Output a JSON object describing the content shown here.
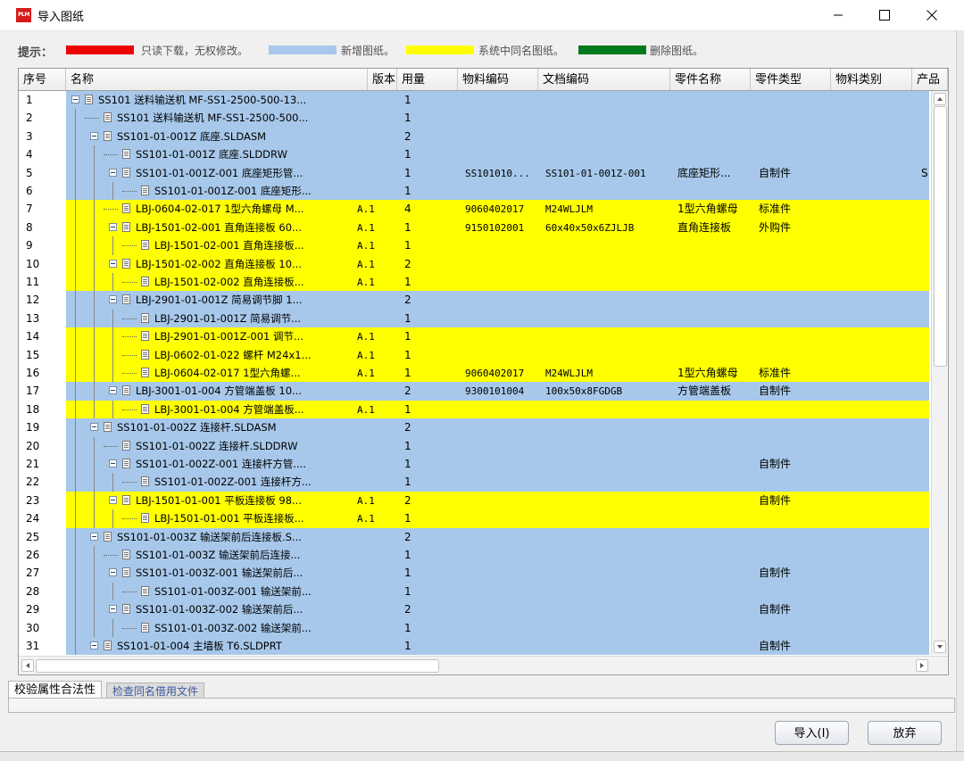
{
  "window": {
    "title": "导入图纸",
    "app_icon_text": "PLM"
  },
  "hint": {
    "label": "提示：",
    "legend": [
      {
        "color": "#ee0000",
        "text": "只读下载，无权修改。"
      },
      {
        "color": "#a7c8ea",
        "text": "新增图纸。"
      },
      {
        "color": "#ffff00",
        "text": "系统中同名图纸。"
      },
      {
        "color": "#007a1c",
        "text": "删除图纸。"
      }
    ]
  },
  "colors": {
    "blue": "#a7c8ea",
    "yellow": "#ffff00"
  },
  "columns": [
    "序号",
    "名称",
    "版本",
    "用量",
    "物料编码",
    "文档编码",
    "零件名称",
    "零件类型",
    "物料类别",
    "产品"
  ],
  "rows": [
    {
      "seq": "1",
      "level": 0,
      "exp": true,
      "name": "SS101 送料输送机 MF-SS1-2500-500-13...",
      "ver": "",
      "qty": "1",
      "mat": "",
      "doc": "",
      "part": "",
      "type": "",
      "cat": "",
      "prod": "",
      "color": "blue"
    },
    {
      "seq": "2",
      "level": 1,
      "exp": false,
      "name": "SS101 送料输送机 MF-SS1-2500-500...",
      "ver": "",
      "qty": "1",
      "mat": "",
      "doc": "",
      "part": "",
      "type": "",
      "cat": "",
      "prod": "",
      "color": "blue"
    },
    {
      "seq": "3",
      "level": 1,
      "exp": true,
      "name": "SS101-01-001Z 底座.SLDASM",
      "ver": "",
      "qty": "2",
      "mat": "",
      "doc": "",
      "part": "",
      "type": "",
      "cat": "",
      "prod": "",
      "color": "blue"
    },
    {
      "seq": "4",
      "level": 2,
      "exp": false,
      "name": "SS101-01-001Z 底座.SLDDRW",
      "ver": "",
      "qty": "1",
      "mat": "",
      "doc": "",
      "part": "",
      "type": "",
      "cat": "",
      "prod": "",
      "color": "blue"
    },
    {
      "seq": "5",
      "level": 2,
      "exp": true,
      "name": "SS101-01-001Z-001 底座矩形管...",
      "ver": "",
      "qty": "1",
      "mat": "SS101010...",
      "doc": "SS101-01-001Z-001",
      "part": "底座矩形...",
      "type": "自制件",
      "cat": "",
      "prod": "S:",
      "color": "blue"
    },
    {
      "seq": "6",
      "level": 3,
      "exp": false,
      "name": "SS101-01-001Z-001 底座矩形...",
      "ver": "",
      "qty": "1",
      "mat": "",
      "doc": "",
      "part": "",
      "type": "",
      "cat": "",
      "prod": "",
      "color": "blue"
    },
    {
      "seq": "7",
      "level": 2,
      "exp": false,
      "name": "LBJ-0604-02-017 1型六角螺母 M...",
      "ver": "A.1",
      "qty": "4",
      "mat": "9060402017",
      "doc": "M24WLJLM",
      "part": "1型六角螺母",
      "type": "标准件",
      "cat": "",
      "prod": "",
      "color": "yellow"
    },
    {
      "seq": "8",
      "level": 2,
      "exp": true,
      "name": "LBJ-1501-02-001 直角连接板 60...",
      "ver": "A.1",
      "qty": "1",
      "mat": "9150102001",
      "doc": "60x40x50x6ZJLJB",
      "part": "直角连接板",
      "type": "外购件",
      "cat": "",
      "prod": "",
      "color": "yellow"
    },
    {
      "seq": "9",
      "level": 3,
      "exp": false,
      "name": "LBJ-1501-02-001 直角连接板...",
      "ver": "A.1",
      "qty": "1",
      "mat": "",
      "doc": "",
      "part": "",
      "type": "",
      "cat": "",
      "prod": "",
      "color": "yellow"
    },
    {
      "seq": "10",
      "level": 2,
      "exp": true,
      "name": "LBJ-1501-02-002 直角连接板 10...",
      "ver": "A.1",
      "qty": "2",
      "mat": "",
      "doc": "",
      "part": "",
      "type": "",
      "cat": "",
      "prod": "",
      "color": "yellow"
    },
    {
      "seq": "11",
      "level": 3,
      "exp": false,
      "name": "LBJ-1501-02-002 直角连接板...",
      "ver": "A.1",
      "qty": "1",
      "mat": "",
      "doc": "",
      "part": "",
      "type": "",
      "cat": "",
      "prod": "",
      "color": "yellow"
    },
    {
      "seq": "12",
      "level": 2,
      "exp": true,
      "name": "LBJ-2901-01-001Z 简易调节脚 1...",
      "ver": "",
      "qty": "2",
      "mat": "",
      "doc": "",
      "part": "",
      "type": "",
      "cat": "",
      "prod": "",
      "color": "blue"
    },
    {
      "seq": "13",
      "level": 3,
      "exp": false,
      "name": "LBJ-2901-01-001Z 简易调节...",
      "ver": "",
      "qty": "1",
      "mat": "",
      "doc": "",
      "part": "",
      "type": "",
      "cat": "",
      "prod": "",
      "color": "blue"
    },
    {
      "seq": "14",
      "level": 3,
      "exp": false,
      "name": "LBJ-2901-01-001Z-001 调节...",
      "ver": "A.1",
      "qty": "1",
      "mat": "",
      "doc": "",
      "part": "",
      "type": "",
      "cat": "",
      "prod": "",
      "color": "yellow"
    },
    {
      "seq": "15",
      "level": 3,
      "exp": false,
      "name": "LBJ-0602-01-022 螺杆 M24x1...",
      "ver": "A.1",
      "qty": "1",
      "mat": "",
      "doc": "",
      "part": "",
      "type": "",
      "cat": "",
      "prod": "",
      "color": "yellow"
    },
    {
      "seq": "16",
      "level": 3,
      "exp": false,
      "name": "LBJ-0604-02-017 1型六角螺...",
      "ver": "A.1",
      "qty": "1",
      "mat": "9060402017",
      "doc": "M24WLJLM",
      "part": "1型六角螺母",
      "type": "标准件",
      "cat": "",
      "prod": "",
      "color": "yellow"
    },
    {
      "seq": "17",
      "level": 2,
      "exp": true,
      "name": "LBJ-3001-01-004 方管端盖板 10...",
      "ver": "",
      "qty": "2",
      "mat": "9300101004",
      "doc": "100x50x8FGDGB",
      "part": "方管端盖板",
      "type": "自制件",
      "cat": "",
      "prod": "",
      "color": "blue"
    },
    {
      "seq": "18",
      "level": 3,
      "exp": false,
      "name": "LBJ-3001-01-004 方管端盖板...",
      "ver": "A.1",
      "qty": "1",
      "mat": "",
      "doc": "",
      "part": "",
      "type": "",
      "cat": "",
      "prod": "",
      "color": "yellow"
    },
    {
      "seq": "19",
      "level": 1,
      "exp": true,
      "name": "SS101-01-002Z 连接杆.SLDASM",
      "ver": "",
      "qty": "2",
      "mat": "",
      "doc": "",
      "part": "",
      "type": "",
      "cat": "",
      "prod": "",
      "color": "blue"
    },
    {
      "seq": "20",
      "level": 2,
      "exp": false,
      "name": "SS101-01-002Z 连接杆.SLDDRW",
      "ver": "",
      "qty": "1",
      "mat": "",
      "doc": "",
      "part": "",
      "type": "",
      "cat": "",
      "prod": "",
      "color": "blue"
    },
    {
      "seq": "21",
      "level": 2,
      "exp": true,
      "name": "SS101-01-002Z-001 连接杆方管....",
      "ver": "",
      "qty": "1",
      "mat": "",
      "doc": "",
      "part": "",
      "type": "自制件",
      "cat": "",
      "prod": "",
      "color": "blue"
    },
    {
      "seq": "22",
      "level": 3,
      "exp": false,
      "name": "SS101-01-002Z-001 连接杆方...",
      "ver": "",
      "qty": "1",
      "mat": "",
      "doc": "",
      "part": "",
      "type": "",
      "cat": "",
      "prod": "",
      "color": "blue"
    },
    {
      "seq": "23",
      "level": 2,
      "exp": true,
      "name": "LBJ-1501-01-001 平板连接板 98...",
      "ver": "A.1",
      "qty": "2",
      "mat": "",
      "doc": "",
      "part": "",
      "type": "自制件",
      "cat": "",
      "prod": "",
      "color": "yellow"
    },
    {
      "seq": "24",
      "level": 3,
      "exp": false,
      "name": "LBJ-1501-01-001 平板连接板...",
      "ver": "A.1",
      "qty": "1",
      "mat": "",
      "doc": "",
      "part": "",
      "type": "",
      "cat": "",
      "prod": "",
      "color": "yellow"
    },
    {
      "seq": "25",
      "level": 1,
      "exp": true,
      "name": "SS101-01-003Z 输送架前后连接板.S...",
      "ver": "",
      "qty": "2",
      "mat": "",
      "doc": "",
      "part": "",
      "type": "",
      "cat": "",
      "prod": "",
      "color": "blue"
    },
    {
      "seq": "26",
      "level": 2,
      "exp": false,
      "name": "SS101-01-003Z 输送架前后连接...",
      "ver": "",
      "qty": "1",
      "mat": "",
      "doc": "",
      "part": "",
      "type": "",
      "cat": "",
      "prod": "",
      "color": "blue"
    },
    {
      "seq": "27",
      "level": 2,
      "exp": true,
      "name": "SS101-01-003Z-001 输送架前后...",
      "ver": "",
      "qty": "1",
      "mat": "",
      "doc": "",
      "part": "",
      "type": "自制件",
      "cat": "",
      "prod": "",
      "color": "blue"
    },
    {
      "seq": "28",
      "level": 3,
      "exp": false,
      "name": "SS101-01-003Z-001 输送架前...",
      "ver": "",
      "qty": "1",
      "mat": "",
      "doc": "",
      "part": "",
      "type": "",
      "cat": "",
      "prod": "",
      "color": "blue"
    },
    {
      "seq": "29",
      "level": 2,
      "exp": true,
      "name": "SS101-01-003Z-002 输送架前后...",
      "ver": "",
      "qty": "2",
      "mat": "",
      "doc": "",
      "part": "",
      "type": "自制件",
      "cat": "",
      "prod": "",
      "color": "blue"
    },
    {
      "seq": "30",
      "level": 3,
      "exp": false,
      "name": "SS101-01-003Z-002 输送架前...",
      "ver": "",
      "qty": "1",
      "mat": "",
      "doc": "",
      "part": "",
      "type": "",
      "cat": "",
      "prod": "",
      "color": "blue"
    },
    {
      "seq": "31",
      "level": 1,
      "exp": true,
      "name": "SS101-01-004 主墙板 T6.SLDPRT",
      "ver": "",
      "qty": "1",
      "mat": "",
      "doc": "",
      "part": "",
      "type": "自制件",
      "cat": "",
      "prod": "",
      "color": "blue"
    }
  ],
  "tabs": [
    "校验属性合法性",
    "检查同名借用文件"
  ],
  "buttons": {
    "import": "导入(I)",
    "discard": "放弃"
  }
}
